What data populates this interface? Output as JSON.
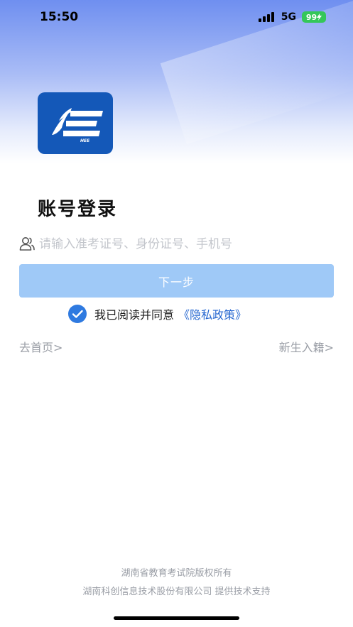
{
  "status_bar": {
    "time": "15:50",
    "network": "5G",
    "battery": "99"
  },
  "login": {
    "title": "账号登录",
    "input_placeholder": "请输入准考证号、身份证号、手机号",
    "next_label": "下一步",
    "agree_text": "我已阅读并同意",
    "privacy_link": "《隐私政策》",
    "home_link": "去首页>",
    "enroll_link": "新生入籍>"
  },
  "footer": {
    "line1": "湖南省教育考试院版权所有",
    "line2": "湖南科创信息技术股份有限公司 提供技术支持"
  },
  "colors": {
    "primary": "#2667d0",
    "button_disabled": "#9fc9f7",
    "logo": "#1458b8",
    "battery": "#34c759"
  }
}
